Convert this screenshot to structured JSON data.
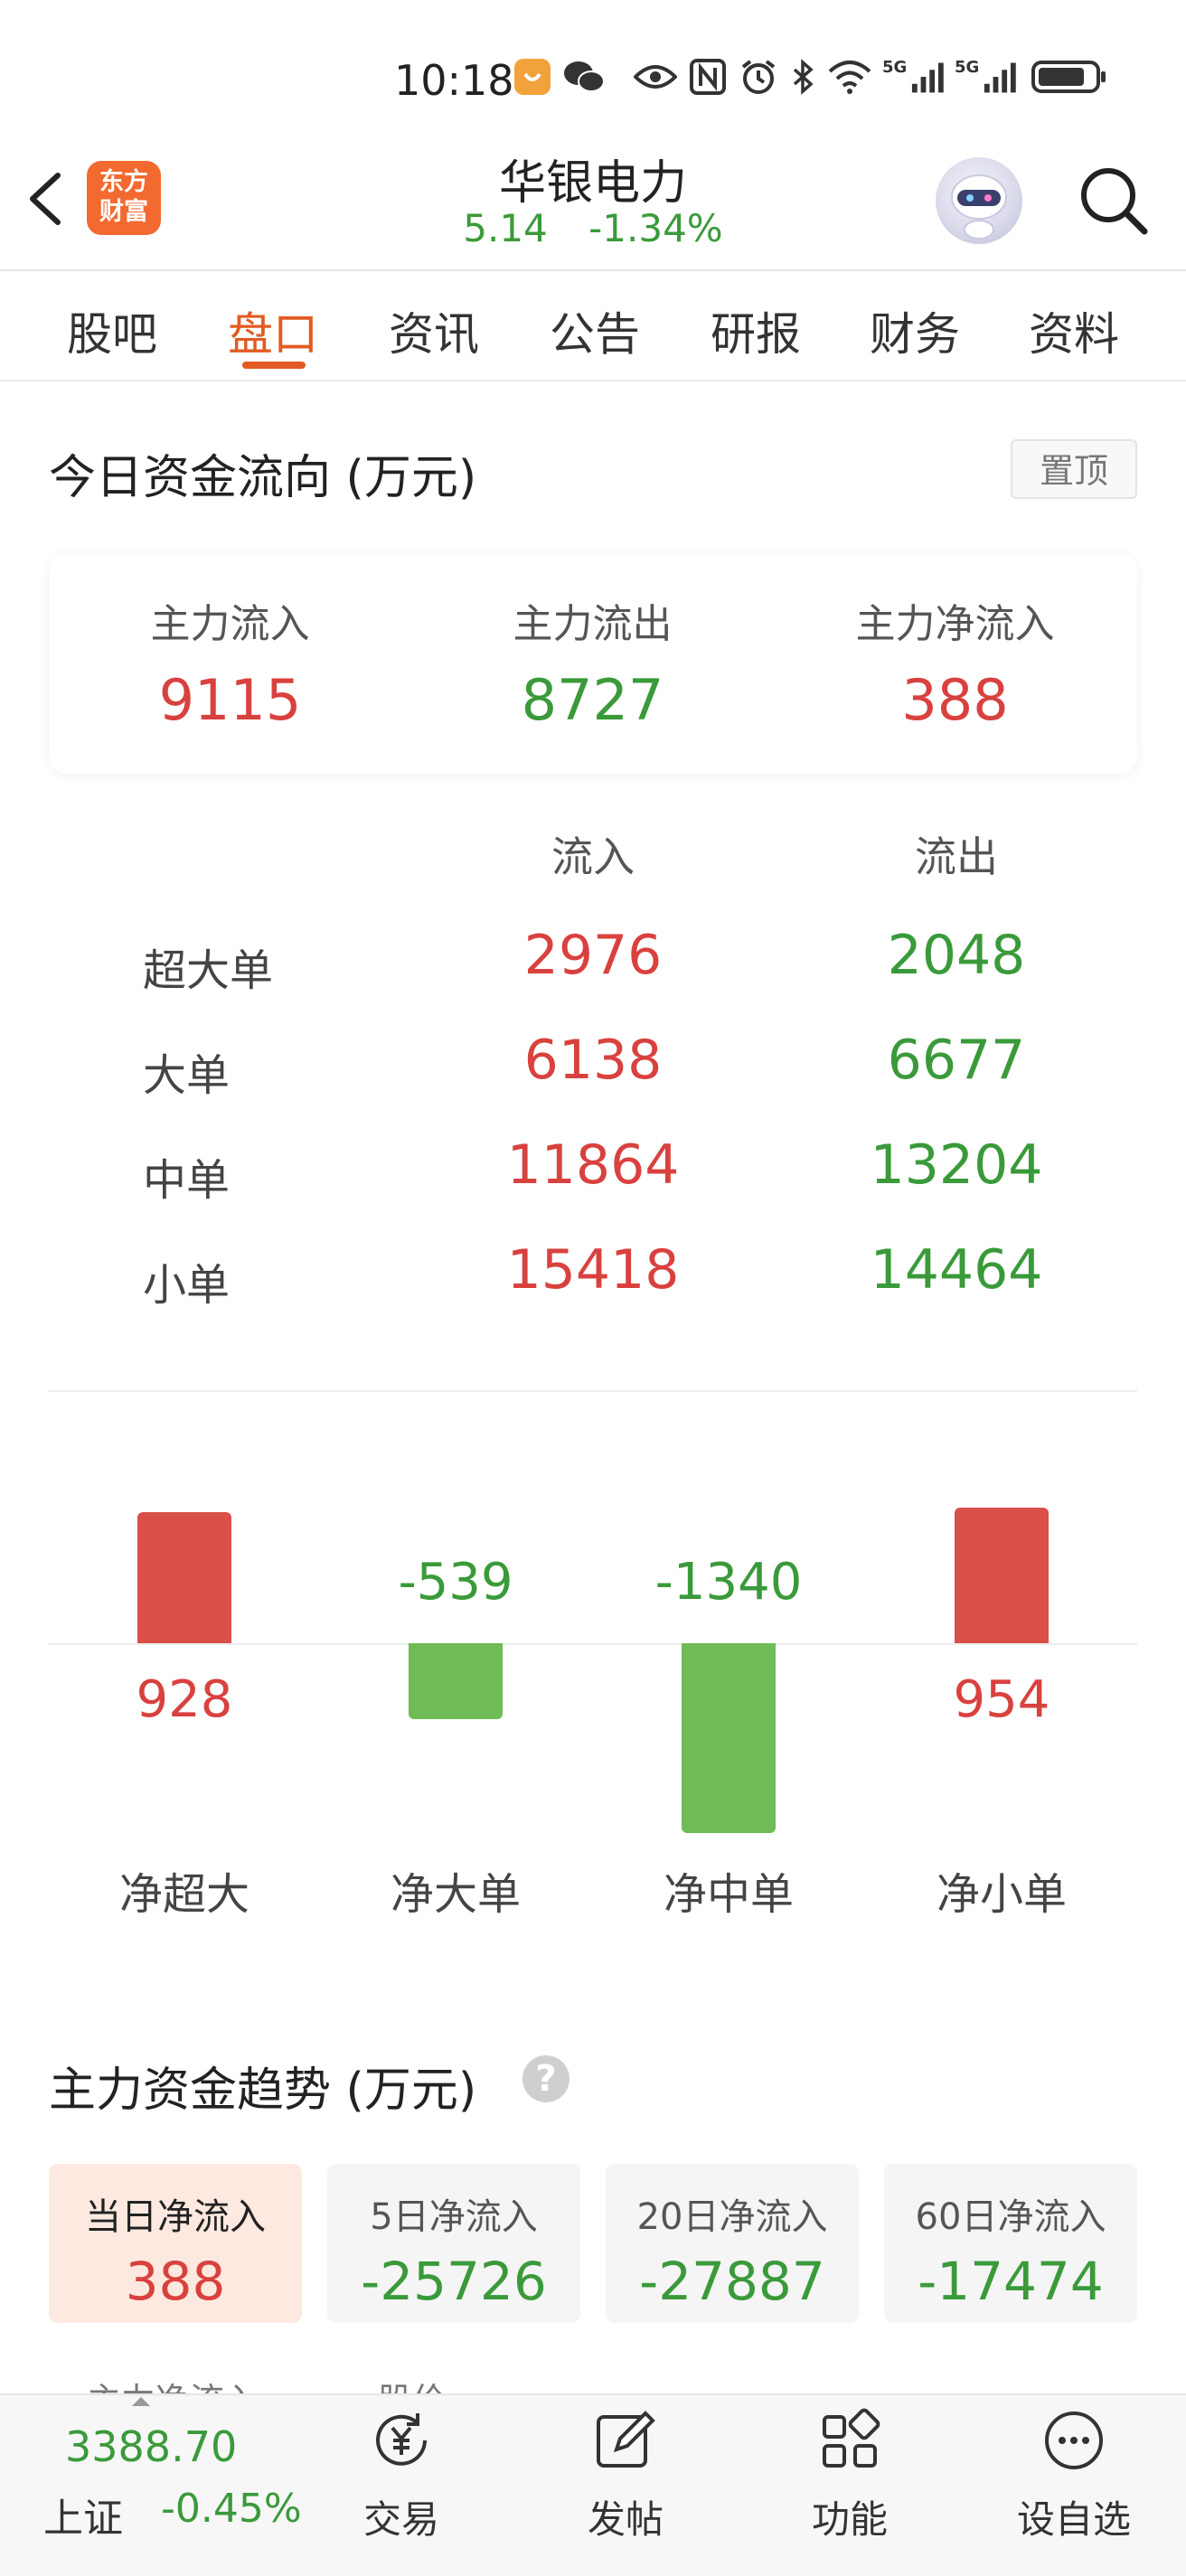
{
  "status_bar": {
    "time": "10:18",
    "network_labels": [
      "5G",
      "5G"
    ]
  },
  "header": {
    "logo_text": [
      "东方",
      "财富"
    ],
    "stock_name": "华银电力",
    "price": "5.14",
    "change_pct": "-1.34%"
  },
  "tabs": [
    "股吧",
    "盘口",
    "资讯",
    "公告",
    "研报",
    "财务",
    "资料"
  ],
  "active_tab": "盘口",
  "fund_flow": {
    "title": "今日资金流向 (万元)",
    "pin_label": "置顶",
    "summary": [
      {
        "label": "主力流入",
        "value": "9115",
        "color": "#d9413e"
      },
      {
        "label": "主力流出",
        "value": "8727",
        "color": "#3a9a3a"
      },
      {
        "label": "主力净流入",
        "value": "388",
        "color": "#d9413e"
      }
    ],
    "table": {
      "columns": [
        "流入",
        "流出"
      ],
      "rows": [
        {
          "label": "超大单",
          "inflow": "2976",
          "outflow": "2048"
        },
        {
          "label": "大单",
          "inflow": "6138",
          "outflow": "6677"
        },
        {
          "label": "中单",
          "inflow": "11864",
          "outflow": "13204"
        },
        {
          "label": "小单",
          "inflow": "15418",
          "outflow": "14464"
        }
      ]
    }
  },
  "chart_data": {
    "type": "bar",
    "categories": [
      "净超大",
      "净大单",
      "净中单",
      "净小单"
    ],
    "values": [
      928,
      -539,
      -1340,
      954
    ],
    "value_labels": [
      "928",
      "-539",
      "-1340",
      "954"
    ],
    "colors": {
      "positive": "#d94f4a",
      "negative": "#6fbb55"
    }
  },
  "trend": {
    "title": "主力资金趋势 (万元)",
    "help_icon": "question-icon",
    "cards": [
      {
        "label": "当日净流入",
        "value": "388",
        "color": "#d9413e",
        "active": true
      },
      {
        "label": "5日净流入",
        "value": "-25726",
        "color": "#3a9a3a",
        "active": false
      },
      {
        "label": "20日净流入",
        "value": "-27887",
        "color": "#3a9a3a",
        "active": false
      },
      {
        "label": "60日净流入",
        "value": "-17474",
        "color": "#3a9a3a",
        "active": false
      }
    ],
    "peek_labels": [
      "主力净流入",
      "股价"
    ]
  },
  "bottom_bar": {
    "index_value": "3388.70",
    "index_name": "上证",
    "index_change": "-0.45%",
    "nav": [
      {
        "label": "交易",
        "icon": "trade-yen-icon"
      },
      {
        "label": "发帖",
        "icon": "compose-icon"
      },
      {
        "label": "功能",
        "icon": "grid-icon"
      },
      {
        "label": "设自选",
        "icon": "more-dots-icon"
      }
    ]
  }
}
